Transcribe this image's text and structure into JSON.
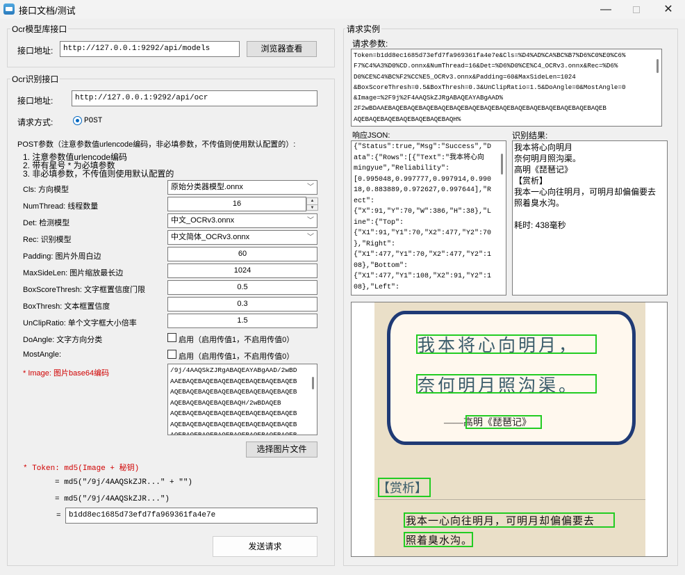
{
  "window": {
    "title": "接口文档/测试",
    "min_glyph": "—",
    "close_glyph": "✕"
  },
  "models_group": {
    "title": "Ocr模型库接口",
    "addr_label": "接口地址:",
    "addr_value": "http://127.0.0.1:9292/api/models",
    "browse_button": "浏览器查看"
  },
  "ocr_group": {
    "title": "Ocr识别接口",
    "addr_label": "接口地址:",
    "addr_value": "http://127.0.0.1:9292/api/ocr",
    "method_label": "请求方式:",
    "method_value": "POST",
    "params_title": "POST参数（注意参数值urlencode编码，非必填参数，不传值则使用默认配置的）:",
    "notes": [
      "1. 注意参数值urlencode编码",
      "2. 带有星号 * 为必填参数",
      "3. 非必填参数，不传值则使用默认配置的"
    ],
    "params": [
      {
        "label": "Cls: 方向模型",
        "value": "原始分类器模型.onnx"
      },
      {
        "label": "NumThread: 线程数量",
        "value": "16"
      },
      {
        "label": "Det: 检测模型",
        "value": "中文_OCRv3.onnx"
      },
      {
        "label": "Rec: 识别模型",
        "value": "中文简体_OCRv3.onnx"
      },
      {
        "label": "Padding: 图片外周白边",
        "value": "60"
      },
      {
        "label": "MaxSideLen: 图片缩放最长边",
        "value": "1024"
      },
      {
        "label": "BoxScoreThresh: 文字框置信度门限",
        "value": "0.5"
      },
      {
        "label": "BoxThresh: 文本框置信度",
        "value": "0.3"
      },
      {
        "label": "UnClipRatio: 单个文字框大小倍率",
        "value": "1.5"
      },
      {
        "label": "DoAngle: 文字方向分类",
        "value": "启用（启用传值1，不启用传值0）"
      },
      {
        "label": "MostAngle:",
        "value": "启用（启用传值1，不启用传值0）"
      }
    ],
    "image_label": "* Image: 图片base64编码",
    "image_value": "/9j/4AAQSkZJRgABAQEAYABgAAD/2wBD\nAAEBAQEBAQEBAQEBAQEBAQEBAQEBAQEB\nAQEBAQEBAQEBAQEBAQEBAQEBAQEBAQEB\nAQEBAQEBAQEBAQEBAQH/2wBDAQEB\nAQEBAQEBAQEBAQEBAQEBAQEBAQEBAQEB\nAQEBAQEBAQEBAQEBAQEBAQEBAQEBAQEB\nAQEBAQEBAQEBAQEBAQEBAQEBAQEBAQEB",
    "choose_file_button": "选择图片文件",
    "token_label": "* Token: md5(Image + 秘钥)",
    "token_line1": "= md5(\"/9j/4AAQSkZJR...\" + \"\")",
    "token_line2": "= md5(\"/9j/4AAQSkZJR...\")",
    "token_eq": "=",
    "token_value": "b1dd8ec1685d73efd7fa969361fa4e7e",
    "send_button": "发送请求"
  },
  "example_group": {
    "title": "请求实例",
    "req_label": "请求参数:",
    "req_text": "Token=b1dd8ec1685d73efd7fa969361fa4e7e&Cls=%D4%AD%CA%BC%B7%D6%C0%E0%C6%\nF7%C4%A3%D0%CD.onnx&NumThread=16&Det=%D6%D0%CE%C4_OCRv3.onnx&Rec=%D6%\nD0%CE%C4%BC%F2%CC%E5_OCRv3.onnx&Padding=60&MaxSideLen=1024\n&BoxScoreThresh=0.5&BoxThresh=0.3&UnClipRatio=1.5&DoAngle=0&MostAngle=0\n&Image=%2F9j%2F4AAQSkZJRgABAQEAYABgAAD%\n2F2wBDAAEBAQEBAQEBAQEBAQEBAQEBAQEBAQEBAQEBAQEBAQEBAQEBAQEBAQEBAQEB\nAQEBAQEBAQEBAQEBAQEBAQEBAQH%",
    "json_label": "响应JSON:",
    "json_text": "{\"Status\":true,\"Msg\":\"Success\",\"D\nata\":{\"Rows\":[{\"Text\":\"我本将心向\nmingyue\",\"Reliability\":\n[0.995048,0.997777,0.997914,0.990\n18,0.883889,0.972627,0.997644],\"R\nect\":\n{\"X\":91,\"Y\":70,\"W\":386,\"H\":38},\"L\nine\":{\"Top\":\n{\"X1\":91,\"Y1\":70,\"X2\":477,\"Y2\":70\n},\"Right\":\n{\"X1\":477,\"Y1\":70,\"X2\":477,\"Y2\":1\n08},\"Bottom\":\n{\"X1\":477,\"Y1\":108,\"X2\":91,\"Y2\":1\n08},\"Left\":",
    "result_label": "识别结果:",
    "result_text": "我本将心向明月\n奈何明月照沟渠。\n高明《琵琶记》\n【赏析】\n我本一心向往明月，可明月却偏偏要去\n照着臭水沟。\n\n耗时: 438毫秒"
  },
  "preview": {
    "line1": "我本将心向明月，",
    "line2": "奈何明月照沟渠。",
    "author": "——高明《琵琶记》",
    "section": "【赏析】",
    "line3": "我本一心向往明月，可明月却偏偏要去",
    "line4": "照着臭水沟。"
  }
}
